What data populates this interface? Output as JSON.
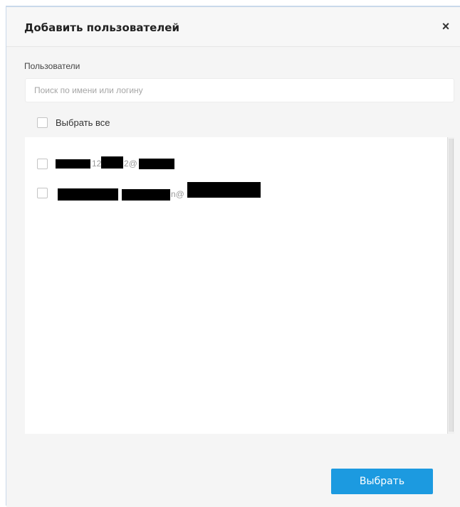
{
  "dialog": {
    "title": "Добавить пользователей",
    "close_icon": "close-icon",
    "close_glyph": "×"
  },
  "users_section": {
    "label": "Пользователи",
    "search_placeholder": "Поиск по имени или логину",
    "search_value": "",
    "select_all_label": "Выбрать все",
    "select_all_checked": false
  },
  "users": [
    {
      "visible_text": "12 2@",
      "checked": false,
      "redacted": true
    },
    {
      "visible_text": "n@",
      "checked": false,
      "redacted": true
    }
  ],
  "footer": {
    "submit_label": "Выбрать"
  },
  "colors": {
    "primary_button": "#1c9ae0",
    "dialog_background": "#f5f5f5",
    "list_background": "#ffffff"
  }
}
